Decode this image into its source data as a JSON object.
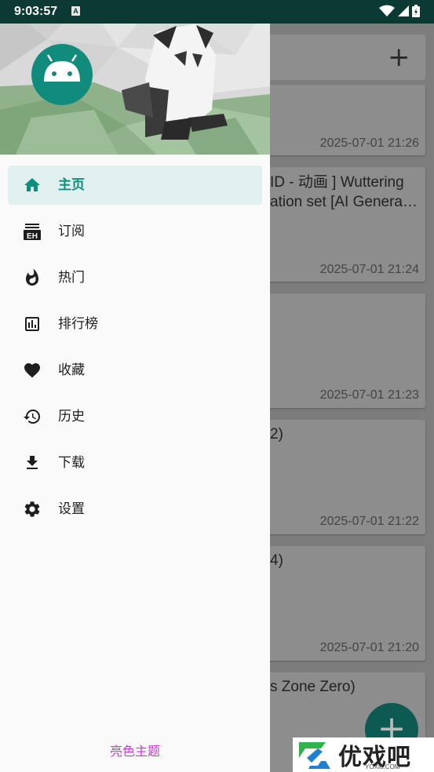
{
  "status_bar": {
    "time": "9:03:57",
    "notif_glyph": "A",
    "icons": [
      "wifi-icon",
      "signal-icon",
      "battery-icon"
    ]
  },
  "background": {
    "cards": [
      {
        "title1": "",
        "title2": "",
        "date": "2025-07-01 21:26"
      },
      {
        "title1": "ID - 动画 ] Wuttering",
        "title2": "ation set [AI Genera…",
        "date": "2025-07-01 21:24"
      },
      {
        "title1": "",
        "title2": "",
        "date": "2025-07-01 21:23"
      },
      {
        "title1": "2)",
        "title2": "",
        "date": "2025-07-01 21:22"
      },
      {
        "title1": "4)",
        "title2": "",
        "date": "2025-07-01 21:20"
      },
      {
        "title1": "s Zone Zero)",
        "title2": "",
        "date": ""
      }
    ],
    "plus_glyph": "+",
    "fab_glyph": "+"
  },
  "drawer": {
    "menu": [
      {
        "label": "主页",
        "icon": "home-icon",
        "active": true
      },
      {
        "label": "订阅",
        "icon": "subscribe-eh-icon"
      },
      {
        "label": "热门",
        "icon": "fire-icon"
      },
      {
        "label": "排行榜",
        "icon": "ranking-chart-icon"
      },
      {
        "label": "收藏",
        "icon": "heart-icon"
      },
      {
        "label": "历史",
        "icon": "history-icon"
      },
      {
        "label": "下载",
        "icon": "download-icon"
      },
      {
        "label": "设置",
        "icon": "settings-gear-icon"
      }
    ],
    "theme_toggle": "亮色主题"
  },
  "watermark": {
    "text": "优戏吧",
    "sub": "YOXI8.COM"
  },
  "colors": {
    "accent": "#0d8f7e",
    "active_bg": "#dff0ee",
    "theme_link": "#c53ad6"
  }
}
